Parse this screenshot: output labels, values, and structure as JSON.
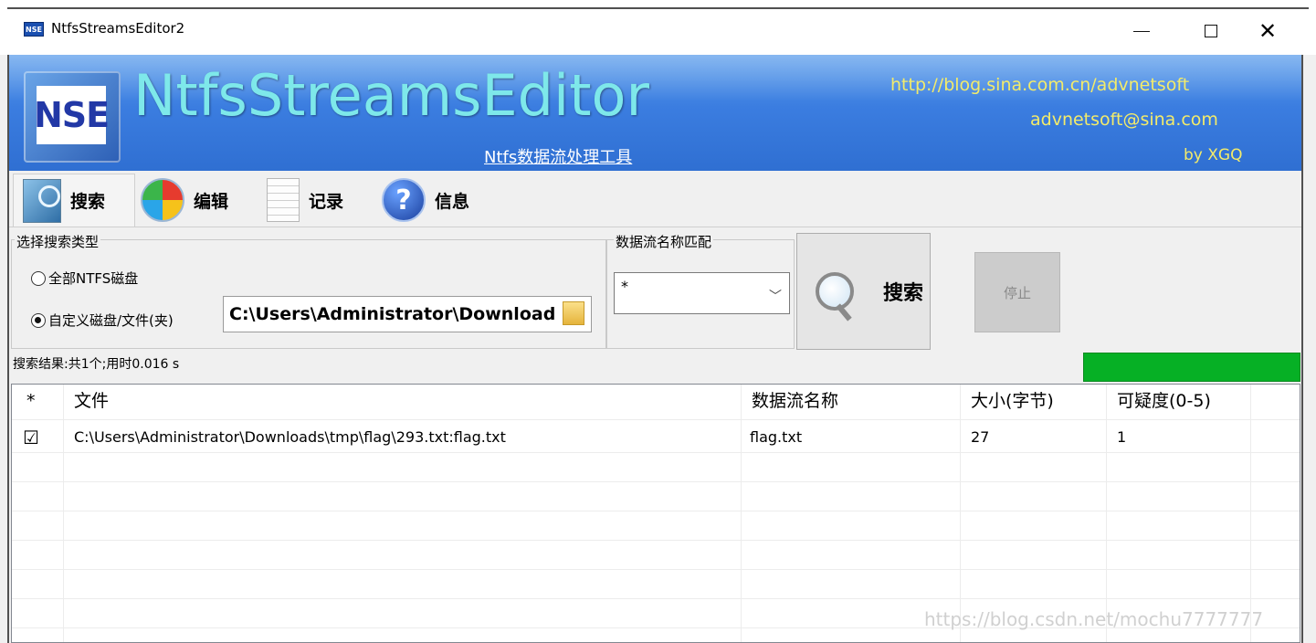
{
  "window": {
    "title": "NtfsStreamsEditor2",
    "app_icon_text": "NSE",
    "controls": [
      "minimize",
      "maximize",
      "close"
    ]
  },
  "banner": {
    "logo_text": "NSE",
    "title": "NtfsStreamsEditor",
    "subtitle": "Ntfs数据流处理工具",
    "url": "http://blog.sina.com.cn/advnetsoft",
    "email": "advnetsoft@sina.com",
    "by": "by XGQ",
    "title_color": "#7ee8ea",
    "link_color": "#f3eb6a"
  },
  "tabs": [
    {
      "label": "搜索",
      "icon": "search-icon",
      "active": true
    },
    {
      "label": "编辑",
      "icon": "edit-icon",
      "active": false
    },
    {
      "label": "记录",
      "icon": "log-icon",
      "active": false
    },
    {
      "label": "信息",
      "icon": "info-icon",
      "active": false
    }
  ],
  "search_panel": {
    "type_group_label": "选择搜索类型",
    "radio_all_label": "全部NTFS磁盘",
    "radio_custom_label": "自定义磁盘/文件(夹)",
    "selected": "custom",
    "path_value": "C:\\Users\\Administrator\\Download",
    "name_group_label": "数据流名称匹配",
    "name_select_value": "*",
    "search_button": "搜索",
    "stop_button": "停止"
  },
  "status": {
    "text": "搜索结果:共1个;用时0.016 s",
    "progress_percent": 100,
    "progress_color": "#06b025"
  },
  "table": {
    "columns": [
      "*",
      "文件",
      "数据流名称",
      "大小(字节)",
      "可疑度(0-5)"
    ],
    "rows": [
      {
        "checked": true,
        "check_glyph": "☑",
        "file": "C:\\Users\\Administrator\\Downloads\\tmp\\flag\\293.txt:flag.txt",
        "stream": "flag.txt",
        "size": "27",
        "suspicion": "1"
      }
    ]
  },
  "watermark": "https://blog.csdn.net/mochu7777777"
}
